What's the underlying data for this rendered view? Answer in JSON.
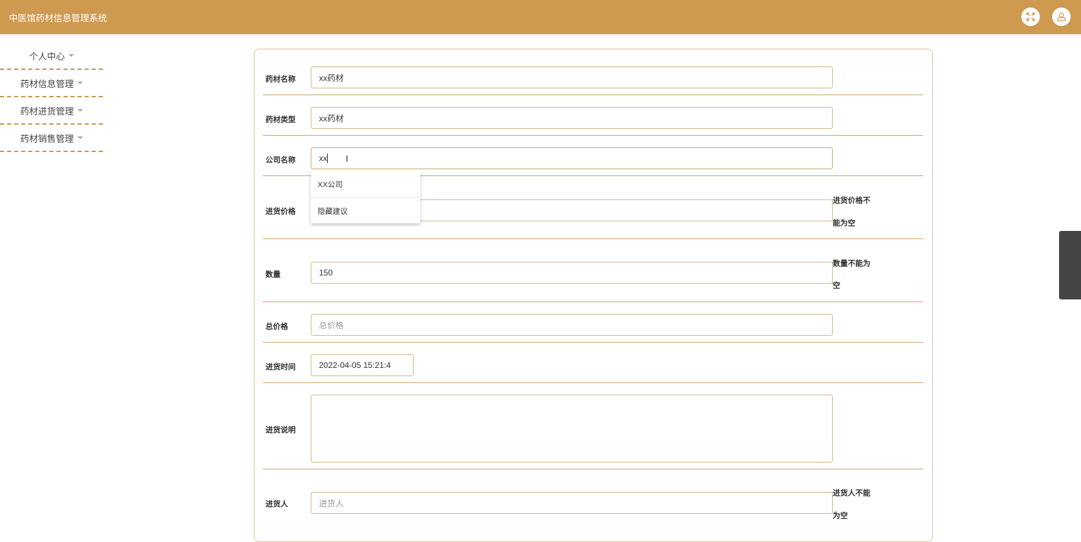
{
  "header": {
    "title": "中医馆药材信息管理系统",
    "icons": [
      "fullscreen-icon",
      "user-icon"
    ]
  },
  "sidebar": {
    "items": [
      {
        "label": "个人中心"
      },
      {
        "label": "药材信息管理"
      },
      {
        "label": "药材进货管理"
      },
      {
        "label": "药材销售管理"
      }
    ]
  },
  "form": {
    "name": {
      "label": "药材名称",
      "value": "xx药材"
    },
    "type": {
      "label": "药材类型",
      "value": "xx药材"
    },
    "company": {
      "label": "公司名称",
      "value": "xx"
    },
    "price": {
      "label": "进货价格",
      "value": "",
      "error_1": "进货价格不",
      "error_2": "能为空"
    },
    "qty": {
      "label": "数量",
      "value": "150",
      "error_1": "数量不能为",
      "error_2": "空"
    },
    "total": {
      "label": "总价格",
      "placeholder": "总价格"
    },
    "time": {
      "label": "进货时间",
      "value": "2022-04-05 15:21:4"
    },
    "desc": {
      "label": "进货说明",
      "value": ""
    },
    "person": {
      "label": "进货人",
      "placeholder": "进货人",
      "error_1": "进货人不能",
      "error_2": "为空"
    }
  },
  "autocomplete": {
    "suggestion": "XX公司",
    "hide": "隐藏建议"
  },
  "colors": {
    "brand": "#cd9a50",
    "border": "#d2b887"
  }
}
